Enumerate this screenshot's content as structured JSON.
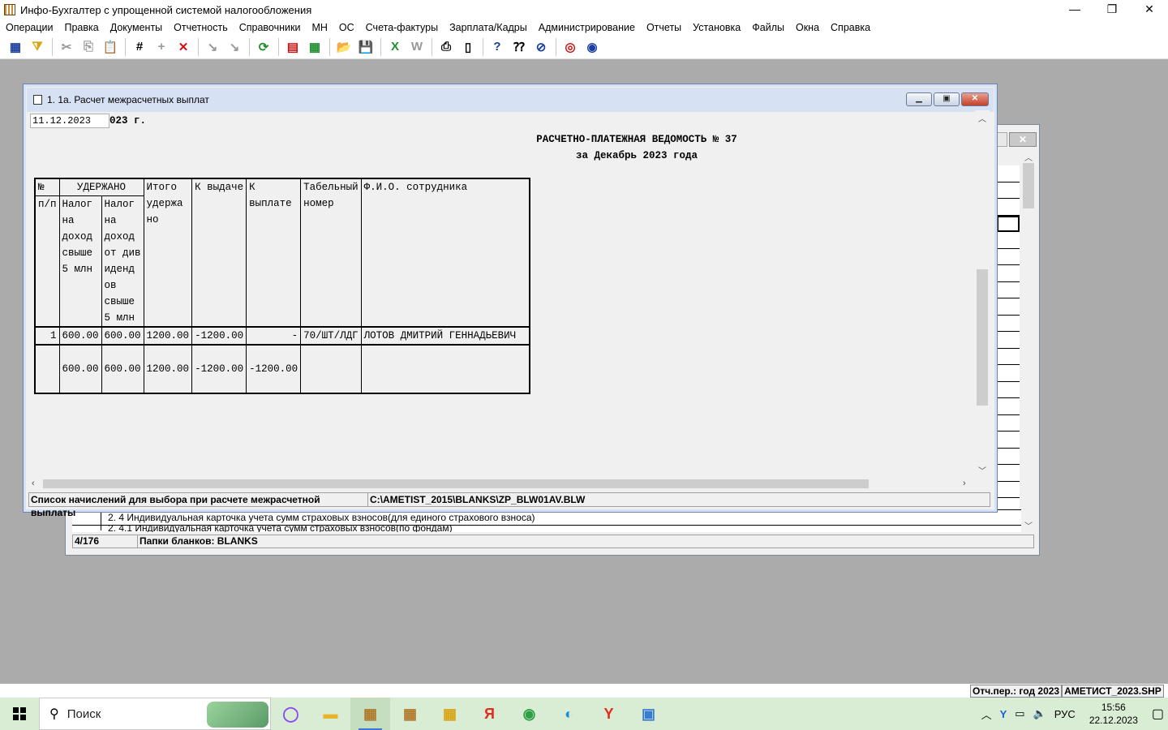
{
  "app": {
    "title": "Инфо-Бухгалтер с упрощенной системой налогообложения",
    "window_controls": [
      "—",
      "❐",
      "✕"
    ]
  },
  "menu": [
    "Операции",
    "Правка",
    "Документы",
    "Отчетность",
    "Справочники",
    "МН",
    "ОС",
    "Счета-фактуры",
    "Зарплата/Кадры",
    "Администрирование",
    "Отчеты",
    "Установка",
    "Файлы",
    "Окна",
    "Справка"
  ],
  "toolbar": {
    "buttons": [
      {
        "name": "table-icon",
        "glyph": "▦"
      },
      {
        "name": "filter-icon",
        "glyph": "⧩"
      },
      {
        "name": "cut-icon",
        "glyph": "✂"
      },
      {
        "name": "copy-icon",
        "glyph": "⎘"
      },
      {
        "name": "paste-icon",
        "glyph": "📋"
      },
      {
        "name": "numbering-icon",
        "glyph": "#"
      },
      {
        "name": "add-icon",
        "glyph": "+"
      },
      {
        "name": "delete-icon",
        "glyph": "✕"
      },
      {
        "name": "mark-icon",
        "glyph": "↘"
      },
      {
        "name": "unmark-icon",
        "glyph": "↘"
      },
      {
        "name": "refresh-icon",
        "glyph": "⟳"
      },
      {
        "name": "document-icon",
        "glyph": "▤"
      },
      {
        "name": "calculator-icon",
        "glyph": "▦"
      },
      {
        "name": "open-folder-icon",
        "glyph": "📂"
      },
      {
        "name": "save-icon",
        "glyph": "💾"
      },
      {
        "name": "excel-icon",
        "glyph": "X"
      },
      {
        "name": "word-icon",
        "glyph": "W"
      },
      {
        "name": "print-icon",
        "glyph": "⎙"
      },
      {
        "name": "preview-icon",
        "glyph": "▯"
      },
      {
        "name": "help-icon",
        "glyph": "?"
      },
      {
        "name": "context-help-icon",
        "glyph": "⁇"
      },
      {
        "name": "compass-icon",
        "glyph": "⊘"
      },
      {
        "name": "support-icon",
        "glyph": "◎"
      },
      {
        "name": "web-icon",
        "glyph": "◉"
      }
    ],
    "colors": {
      "green": "#1f8f2f",
      "red": "#cc1111",
      "blue": "#1b3fa0",
      "yellow": "#d9a514"
    }
  },
  "bg_window": {
    "row1": "2. 4 Индивидуальная карточка учета сумм страховых взносов(для единого страхового взноса)",
    "row2": "2. 4.1 Индивидуальная карточка учета сумм страховых взносов(по фондам)",
    "status_count": "4/176",
    "status_folder": "Папки бланков: BLANKS"
  },
  "main_window": {
    "title": "1. 1а. Расчет межрасчетных выплат",
    "date_value": "11.12.2023",
    "date_suffix": "023 г.",
    "report_title_1": "РАСЧЕТНО-ПЛАТЕЖНАЯ ВЕДОМОСТЬ № 37",
    "report_title_2": "за Декабрь 2023 года",
    "table": {
      "h_num_1": "№",
      "h_num_2": "п/п",
      "h_withheld": "УДЕРЖАНО",
      "h_tax1": "Налог\nна\nдоход\nсвыше\n5 млн",
      "h_tax2": "Налог\nна\nдоход\nот див\nиденд\nов\nсвыше\n5 млн",
      "h_total": "Итого\nудержа\nно",
      "h_issue": "К выдаче",
      "h_pay": "К\nвыплате",
      "h_tab": "Табельный\nномер",
      "h_fio": "Ф.И.О. сотрудника",
      "row": {
        "num": "1",
        "tax1": "600.00",
        "tax2": "600.00",
        "total": "1200.00",
        "issue": "-1200.00",
        "pay": "-",
        "tab": "70/ШТ/ЛДГ",
        "fio": "ЛОТОВ ДМИТРИЙ ГЕННАДЬЕВИЧ"
      },
      "totals": {
        "tax1": "600.00",
        "tax2": "600.00",
        "total": "1200.00",
        "issue": "-1200.00",
        "pay": "-1200.00"
      }
    },
    "status_left": "Список начислений для выбора при расчете межрасчетной выплаты",
    "status_right": "C:\\AMETIST_2015\\BLANKS\\ZP_BLW01AV.BLW"
  },
  "app_status": {
    "period": "Отч.пер.: год 2023",
    "file": "АМЕТИСТ_2023.SHP"
  },
  "taskbar": {
    "search_placeholder": "Поиск",
    "apps": [
      {
        "name": "alice-icon",
        "glyph": "◯",
        "color": "#8a4af0"
      },
      {
        "name": "explorer-icon",
        "glyph": "▬",
        "color": "#e8b32a"
      },
      {
        "name": "abacus-app-icon",
        "glyph": "▦",
        "color": "#b0782a"
      },
      {
        "name": "abacus-app2-icon",
        "glyph": "▦",
        "color": "#b0782a"
      },
      {
        "name": "abacus-app3-icon",
        "glyph": "▦",
        "color": "#d9a514"
      },
      {
        "name": "yandex-icon",
        "glyph": "Я",
        "color": "#e42a1c"
      },
      {
        "name": "chrome-icon",
        "glyph": "◉",
        "color": "#2f9e44"
      },
      {
        "name": "edge-icon",
        "glyph": "◐",
        "color": "#1a8fd6"
      },
      {
        "name": "yandex-browser-icon",
        "glyph": "Y",
        "color": "#e42a1c"
      },
      {
        "name": "app-window-icon",
        "glyph": "▣",
        "color": "#3a7bd5"
      }
    ],
    "tray": {
      "lang": "РУС",
      "time": "15:56",
      "date": "22.12.2023"
    }
  }
}
